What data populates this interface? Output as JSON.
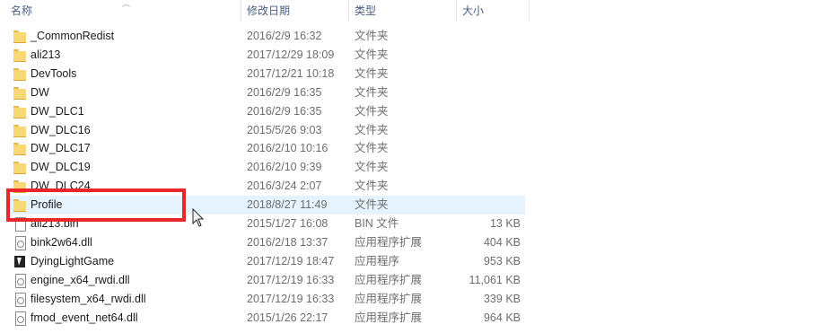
{
  "columns": {
    "name": "名称",
    "modified": "修改日期",
    "type": "类型",
    "size": "大小"
  },
  "files": [
    {
      "name": "_CommonRedist",
      "modified": "2016/2/9 16:32",
      "type": "文件夹",
      "size": "",
      "icon": "folder-icon"
    },
    {
      "name": "ali213",
      "modified": "2017/12/29 18:09",
      "type": "文件夹",
      "size": "",
      "icon": "folder-icon"
    },
    {
      "name": "DevTools",
      "modified": "2017/12/21 10:18",
      "type": "文件夹",
      "size": "",
      "icon": "folder-icon"
    },
    {
      "name": "DW",
      "modified": "2016/2/9 16:35",
      "type": "文件夹",
      "size": "",
      "icon": "folder-icon"
    },
    {
      "name": "DW_DLC1",
      "modified": "2016/2/9 16:35",
      "type": "文件夹",
      "size": "",
      "icon": "folder-icon"
    },
    {
      "name": "DW_DLC16",
      "modified": "2015/5/26 9:03",
      "type": "文件夹",
      "size": "",
      "icon": "folder-icon"
    },
    {
      "name": "DW_DLC17",
      "modified": "2016/2/10 10:16",
      "type": "文件夹",
      "size": "",
      "icon": "folder-icon"
    },
    {
      "name": "DW_DLC19",
      "modified": "2016/2/10 9:39",
      "type": "文件夹",
      "size": "",
      "icon": "folder-icon"
    },
    {
      "name": "DW_DLC24",
      "modified": "2016/3/24 2:07",
      "type": "文件夹",
      "size": "",
      "icon": "folder-icon"
    },
    {
      "name": "Profile",
      "modified": "2018/8/27 11:49",
      "type": "文件夹",
      "size": "",
      "icon": "folder-icon",
      "selected": true
    },
    {
      "name": "ali213.bin",
      "modified": "2015/1/27 16:08",
      "type": "BIN 文件",
      "size": "13 KB",
      "icon": "file-icon"
    },
    {
      "name": "bink2w64.dll",
      "modified": "2016/2/18 13:37",
      "type": "应用程序扩展",
      "size": "404 KB",
      "icon": "dll-icon"
    },
    {
      "name": "DyingLightGame",
      "modified": "2017/12/19 18:47",
      "type": "应用程序",
      "size": "953 KB",
      "icon": "app-icon"
    },
    {
      "name": "engine_x64_rwdi.dll",
      "modified": "2017/12/19 16:33",
      "type": "应用程序扩展",
      "size": "11,061 KB",
      "icon": "dll-icon"
    },
    {
      "name": "filesystem_x64_rwdi.dll",
      "modified": "2017/12/19 16:33",
      "type": "应用程序扩展",
      "size": "339 KB",
      "icon": "dll-icon"
    },
    {
      "name": "fmod_event_net64.dll",
      "modified": "2015/1/26 22:17",
      "type": "应用程序扩展",
      "size": "964 KB",
      "icon": "dll-icon"
    }
  ],
  "highlight_color": "#e8262b",
  "selection_color": "#e5f3ff"
}
